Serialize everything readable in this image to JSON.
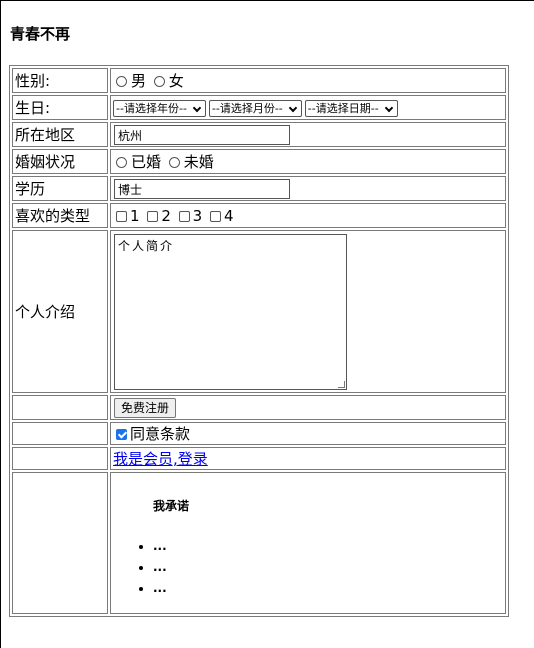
{
  "page": {
    "title": "青春不再"
  },
  "form": {
    "gender": {
      "label": "性别:",
      "options": [
        "男",
        "女"
      ]
    },
    "birthday": {
      "label": "生日:",
      "year": "--请选择年份--",
      "month": "--请选择月份--",
      "day": "--请选择日期--"
    },
    "region": {
      "label": "所在地区",
      "value": "杭州"
    },
    "marital": {
      "label": "婚姻状况",
      "options": [
        "已婚",
        "未婚"
      ]
    },
    "education": {
      "label": "学历",
      "value": "博士"
    },
    "types": {
      "label": "喜欢的类型",
      "options": [
        "1",
        "2",
        "3",
        "4"
      ]
    },
    "intro": {
      "label": "个人介绍",
      "value": "个人简介"
    },
    "register": {
      "label": "免费注册"
    },
    "agree": {
      "label": "同意条款",
      "checked": true
    },
    "login": {
      "label": "我是会员,登录"
    },
    "promise": {
      "title": "我承诺",
      "items": [
        "...",
        "...",
        "..."
      ]
    }
  }
}
